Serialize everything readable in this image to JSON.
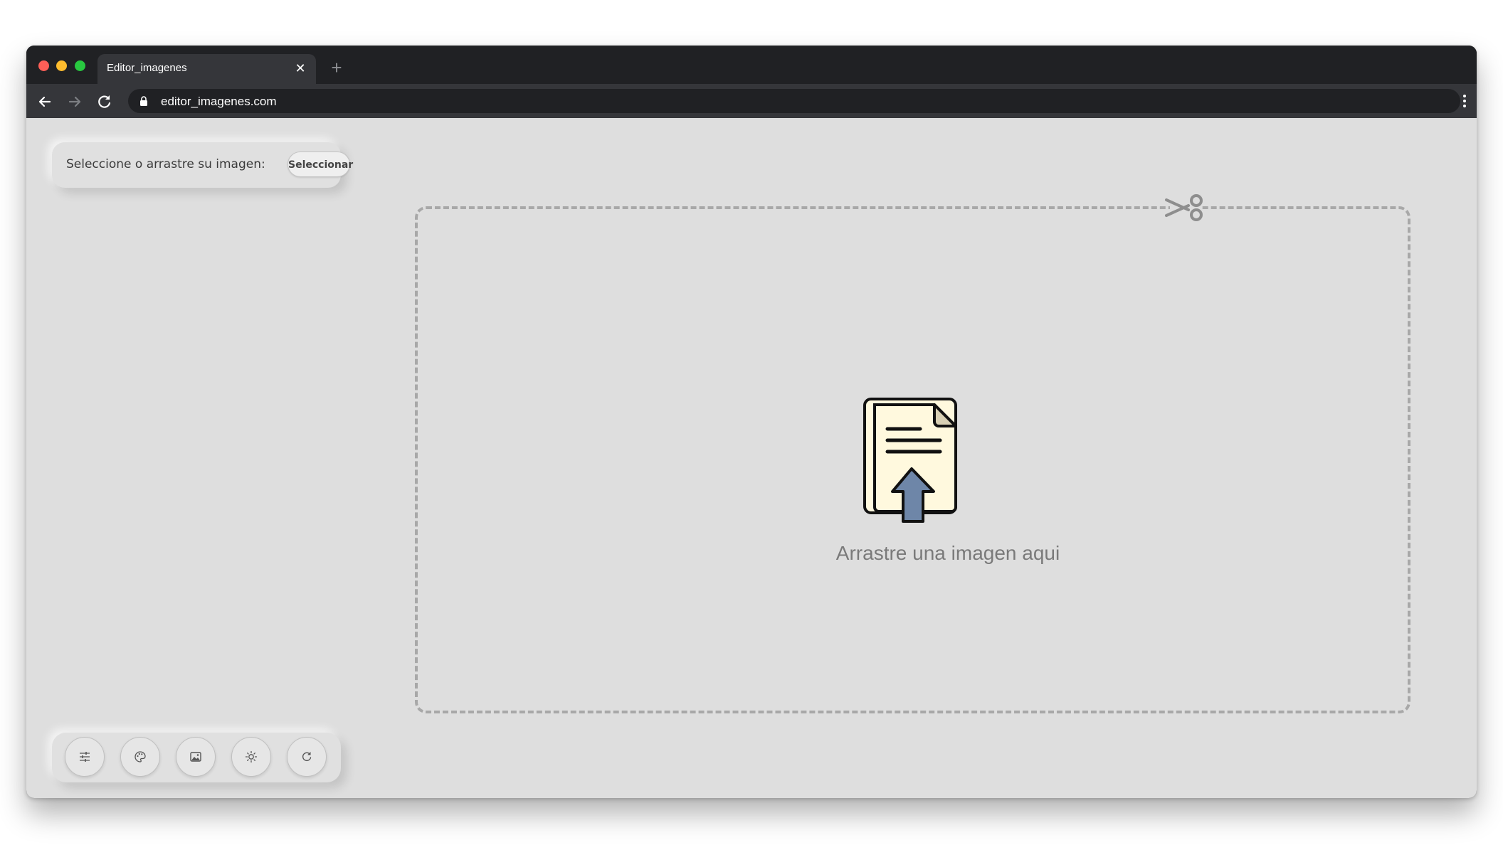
{
  "browser": {
    "tab_title": "Editor_imagenes",
    "tab_close": "✕",
    "new_tab": "+",
    "url": "editor_imagenes.com"
  },
  "select_panel": {
    "label": "Seleccione o arrastre su imagen:",
    "button_label": "Seleccionar"
  },
  "dropzone": {
    "text": "Arrastre una imagen aqui",
    "icon": "file-upload-icon",
    "corner_icon": "scissors-icon"
  },
  "toolbar_buttons": [
    {
      "icon": "sliders-icon"
    },
    {
      "icon": "palette-icon"
    },
    {
      "icon": "image-icon"
    },
    {
      "icon": "brightness-icon"
    },
    {
      "icon": "rotate-icon"
    }
  ],
  "colors": {
    "chrome_dark": "#202124",
    "chrome_tab": "#35363a",
    "content_bg": "#dedede",
    "dashed_border": "#a8a8a8",
    "icon_page": "#fff9de",
    "icon_arrow": "#6e86a8"
  }
}
